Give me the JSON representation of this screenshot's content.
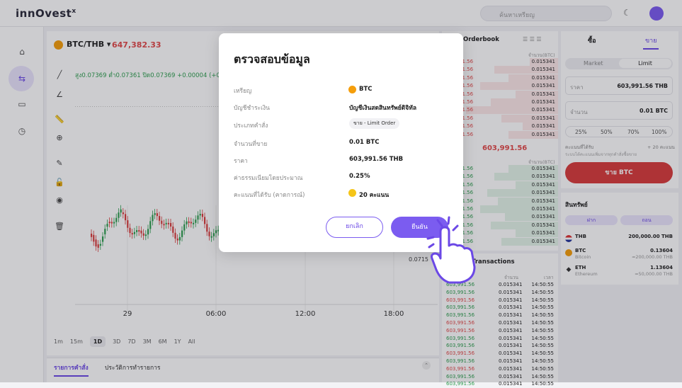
{
  "header": {
    "logo": "innOvest",
    "logo_mark": "x",
    "search_placeholder": "ค้นหาเหรียญ"
  },
  "market": {
    "pair": "BTC/THB",
    "price": "647,382.33",
    "ohlc": "สูง0.07369 ต่ำ0.07361 ปิด0.07369 +0.00004 (+0"
  },
  "chart": {
    "x_labels": [
      "29",
      "06:00",
      "12:00",
      "18:00"
    ],
    "timeframes": [
      "1m",
      "15m",
      "1D",
      "3D",
      "7D",
      "3M",
      "6M",
      "1Y",
      "All"
    ],
    "active_timeframe": "1D",
    "price_tag": "0.0715"
  },
  "bottom_tabs": {
    "orders": "รายการคำสั่ง",
    "history": "ประวัติการทำรายการ"
  },
  "orderbook": {
    "title": "Orderbook",
    "col_qty": "จำนวน(BTC)",
    "asks": [
      {
        "p": "603,991.56",
        "q": "0.015341"
      },
      {
        "p": "603,991.56",
        "q": "0.015341"
      },
      {
        "p": "603,991.56",
        "q": "0.015341"
      },
      {
        "p": "603,991.56",
        "q": "0.015341"
      },
      {
        "p": "603,991.56",
        "q": "0.015341"
      },
      {
        "p": "603,991.56",
        "q": "0.015341"
      },
      {
        "p": "603,991.56",
        "q": "0.015341"
      },
      {
        "p": "603,991.56",
        "q": "0.015341"
      },
      {
        "p": "603,991.56",
        "q": "0.015341"
      },
      {
        "p": "603,991.56",
        "q": "0.015341"
      }
    ],
    "mid_price": "603,991.56",
    "bids": [
      {
        "p": "603,991.56",
        "q": "0.015341"
      },
      {
        "p": "603,991.56",
        "q": "0.015341"
      },
      {
        "p": "603,991.56",
        "q": "0.015341"
      },
      {
        "p": "603,991.56",
        "q": "0.015341"
      },
      {
        "p": "603,991.56",
        "q": "0.015341"
      },
      {
        "p": "603,991.56",
        "q": "0.015341"
      },
      {
        "p": "603,991.56",
        "q": "0.015341"
      },
      {
        "p": "603,991.56",
        "q": "0.015341"
      },
      {
        "p": "603,991.56",
        "q": "0.015341"
      },
      {
        "p": "603,991.56",
        "q": "0.015341"
      }
    ]
  },
  "transactions": {
    "title": "Transactions",
    "col_qty": "จำนวน",
    "col_time": "เวลา",
    "rows": [
      {
        "p": "603,991.56",
        "q": "0.015341",
        "t": "14:50:55",
        "side": "buy"
      },
      {
        "p": "603,991.56",
        "q": "0.015341",
        "t": "14:50:55",
        "side": "buy"
      },
      {
        "p": "603,991.56",
        "q": "0.015341",
        "t": "14:50:55",
        "side": "sell"
      },
      {
        "p": "603,991.56",
        "q": "0.015341",
        "t": "14:50:55",
        "side": "buy"
      },
      {
        "p": "603,991.56",
        "q": "0.015341",
        "t": "14:50:55",
        "side": "buy"
      },
      {
        "p": "603,991.56",
        "q": "0.015341",
        "t": "14:50:55",
        "side": "sell"
      },
      {
        "p": "603,991.56",
        "q": "0.015341",
        "t": "14:50:55",
        "side": "sell"
      },
      {
        "p": "603,991.56",
        "q": "0.015341",
        "t": "14:50:55",
        "side": "buy"
      },
      {
        "p": "603,991.56",
        "q": "0.015341",
        "t": "14:50:55",
        "side": "buy"
      },
      {
        "p": "603,991.56",
        "q": "0.015341",
        "t": "14:50:55",
        "side": "sell"
      },
      {
        "p": "603,991.56",
        "q": "0.015341",
        "t": "14:50:55",
        "side": "buy"
      },
      {
        "p": "603,991.56",
        "q": "0.015341",
        "t": "14:50:55",
        "side": "sell"
      },
      {
        "p": "603,991.56",
        "q": "0.015341",
        "t": "14:50:55",
        "side": "buy"
      },
      {
        "p": "603,991.56",
        "q": "0.015341",
        "t": "14:50:55",
        "side": "buy"
      }
    ]
  },
  "trade": {
    "tab_buy": "ซื้อ",
    "tab_sell": "ขาย",
    "seg_market": "Market",
    "seg_limit": "Limit",
    "price_label": "ราคา",
    "price_value": "603,991.56 THB",
    "amount_label": "จำนวน",
    "amount_value": "0.01 BTC",
    "pcts": [
      "25%",
      "50%",
      "70%",
      "100%"
    ],
    "avail_label": "คะแนนที่ได้รับ",
    "avail_value": "+ 20 คะแนน",
    "avail_note": "ระบบได้คะแนนเพิ่มจากทุกคำสั่งซื้อขาย",
    "sell_button": "ขาย BTC"
  },
  "assets": {
    "title": "สินทรัพย์",
    "deposit": "ฝาก",
    "withdraw": "ถอน",
    "rows": [
      {
        "name": "THB",
        "sub": "",
        "amount": "200,000.00 THB",
        "sub_amount": ""
      },
      {
        "name": "BTC",
        "sub": "Bitcoin",
        "amount": "0.13604",
        "sub_amount": "≈200,000.00 THB"
      },
      {
        "name": "ETH",
        "sub": "Ethereum",
        "amount": "1.13604",
        "sub_amount": "≈50,000.00 THB"
      }
    ]
  },
  "modal": {
    "title": "ตรวจสอบข้อมูล",
    "rows": [
      {
        "k": "เหรียญ",
        "v": "BTC"
      },
      {
        "k": "บัญชีชำระเงิน",
        "v": "บัญชีเงินสดสินทรัพย์ดิจิทัล"
      },
      {
        "k": "ประเภทคำสั่ง",
        "v": "ขาย - Limit Order"
      },
      {
        "k": "จำนวนที่ขาย",
        "v": "0.01 BTC"
      },
      {
        "k": "ราคา",
        "v": "603,991.56 THB"
      },
      {
        "k": "ค่าธรรมเนียมโดยประมาณ",
        "v": "0.25%"
      },
      {
        "k": "คะแนนที่ได้รับ (คาดการณ์)",
        "v": "20 คะแนน"
      }
    ],
    "cancel": "ยกเลิก",
    "confirm": "ยืนยัน"
  },
  "colors": {
    "accent": "#7b5cf0",
    "sell": "#d93c3c",
    "buy": "#2e9e4f"
  }
}
